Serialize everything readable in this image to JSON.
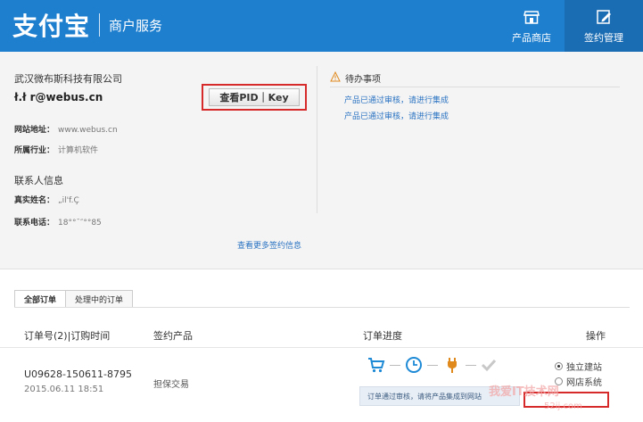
{
  "header": {
    "logo_text": "支付宝",
    "logo_sub": "商户服务",
    "nav": [
      {
        "label": "产品商店"
      },
      {
        "label": "签约管理"
      }
    ]
  },
  "account": {
    "company": "武汉微布斯科技有限公司",
    "email": "ł.ł r@webus.cn",
    "pid_button": "查看PID｜Key",
    "website_label": "网站地址：",
    "website_value": "www.webus.cn",
    "industry_label": "所属行业：",
    "industry_value": "计算机软件",
    "contact_title": "联系人信息",
    "realname_label": "真实姓名：",
    "realname_value": "„il'f.Ç",
    "phone_label": "联系电话：",
    "phone_value": "18°°ˉ″°°85",
    "more_link": "查看更多签约信息"
  },
  "todo": {
    "title": "待办事项",
    "items": [
      "产品已通过审核，请进行集成",
      "产品已通过审核，请进行集成"
    ]
  },
  "tabs": [
    {
      "label": "全部订单",
      "active": true
    },
    {
      "label": "处理中的订单",
      "active": false
    }
  ],
  "table": {
    "headers": {
      "order": "订单号(2)|订购时间",
      "product": "签约产品",
      "progress": "订单进度",
      "action": "操作"
    },
    "rows": [
      {
        "order_no": "U09628-150611-8795",
        "time": "2015.06.11 18:51",
        "product": "担保交易",
        "progress_note": "订单通过审核，请将产品集成到网站",
        "options": [
          "独立建站",
          "网店系统"
        ],
        "selected_option": "独立建站"
      }
    ]
  },
  "watermark": {
    "line1": "我爱IT技术网",
    "line2": "52ij.com"
  },
  "colors": {
    "header_blue": "#1f7fcf",
    "nav_active": "#1a6cb3",
    "link_blue": "#2a73c2",
    "highlight_red": "#d62a2a"
  }
}
